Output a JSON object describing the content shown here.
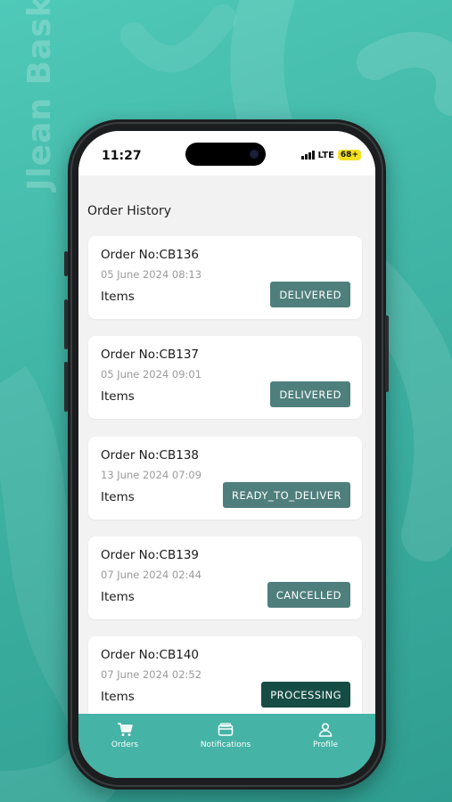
{
  "brand": {
    "logo_text": "Jlean Basket"
  },
  "statusbar": {
    "time": "11:27",
    "network": "LTE",
    "battery": "68+"
  },
  "page": {
    "title": "Order History"
  },
  "orders": [
    {
      "order_no": "Order No:CB136",
      "date": "05 June 2024 08:13",
      "items_label": "Items",
      "status": "DELIVERED",
      "status_color": "#4f7f7c"
    },
    {
      "order_no": "Order No:CB137",
      "date": "05 June 2024 09:01",
      "items_label": "Items",
      "status": "DELIVERED",
      "status_color": "#4f7f7c"
    },
    {
      "order_no": "Order No:CB138",
      "date": "13 June 2024 07:09",
      "items_label": "Items",
      "status": "READY_TO_DELIVER",
      "status_color": "#4f7f7c"
    },
    {
      "order_no": "Order No:CB139",
      "date": "07 June 2024 02:44",
      "items_label": "Items",
      "status": "CANCELLED",
      "status_color": "#4f7f7c"
    },
    {
      "order_no": "Order No:CB140",
      "date": "07 June 2024 02:52",
      "items_label": "Items",
      "status": "PROCESSING",
      "status_color": "#154d45"
    }
  ],
  "bottom_nav": {
    "items": [
      {
        "label": "Orders",
        "icon": "cart-icon"
      },
      {
        "label": "Notifications",
        "icon": "card-icon"
      },
      {
        "label": "Profile",
        "icon": "user-icon"
      }
    ]
  },
  "colors": {
    "background": "#3fb3a4",
    "nav": "#45b3a5",
    "status_default": "#4f7f7c",
    "status_processing": "#154d45"
  }
}
